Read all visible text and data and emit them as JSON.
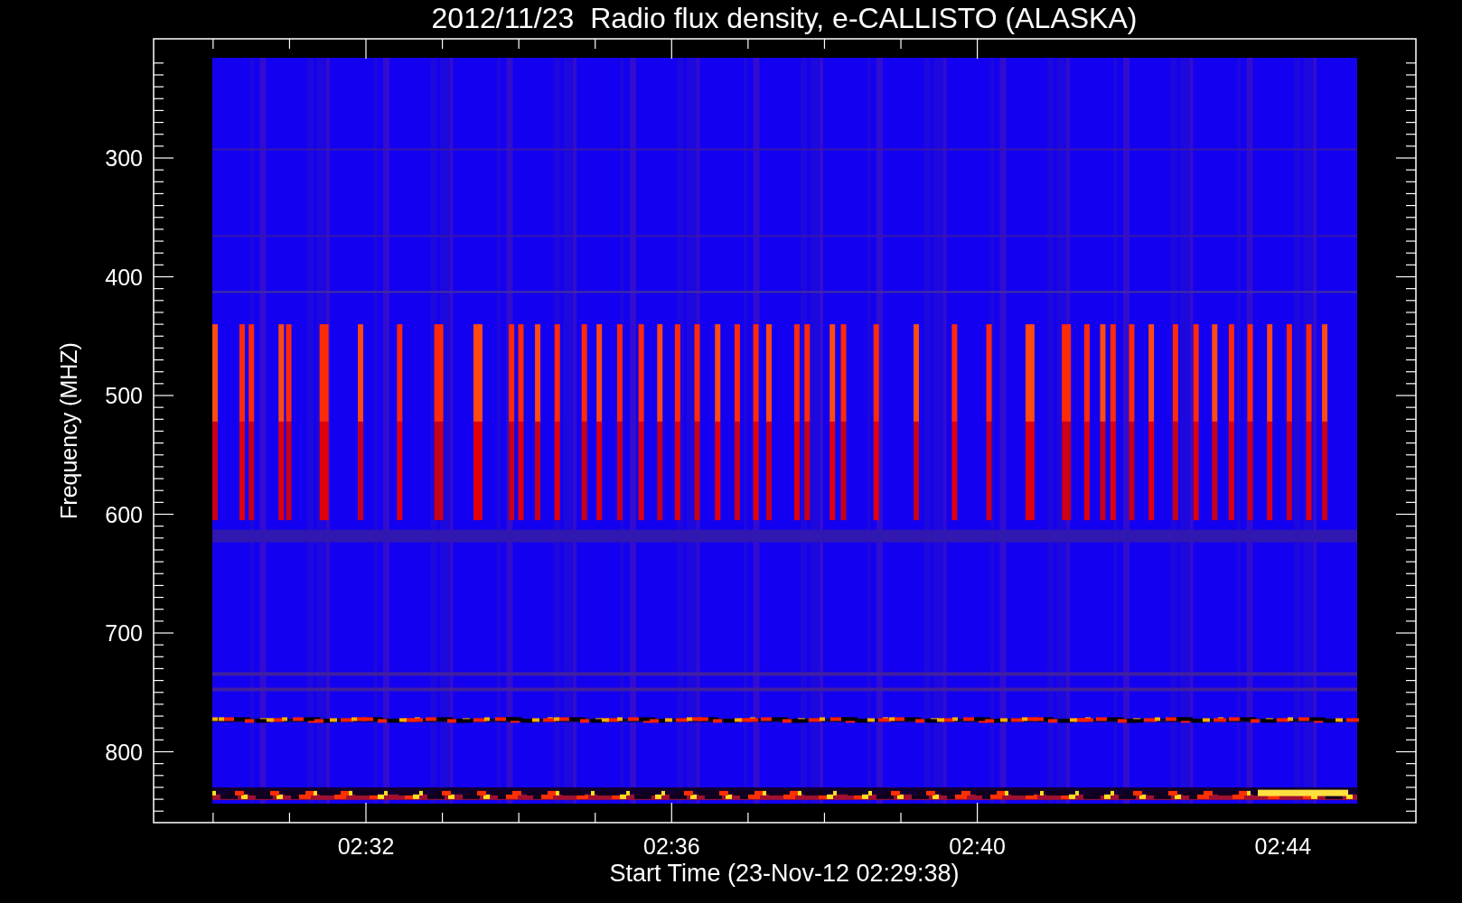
{
  "title": "2012/11/23  Radio flux density, e-CALLISTO (ALASKA)",
  "y_axis": {
    "label": "Frequency (MHZ)",
    "ticks": [
      "300",
      "400",
      "500",
      "600",
      "700",
      "800"
    ]
  },
  "x_axis": {
    "label": "Start Time (23-Nov-12 02:29:38)",
    "ticks": [
      "02:32",
      "02:36",
      "02:40",
      "02:44"
    ]
  }
}
